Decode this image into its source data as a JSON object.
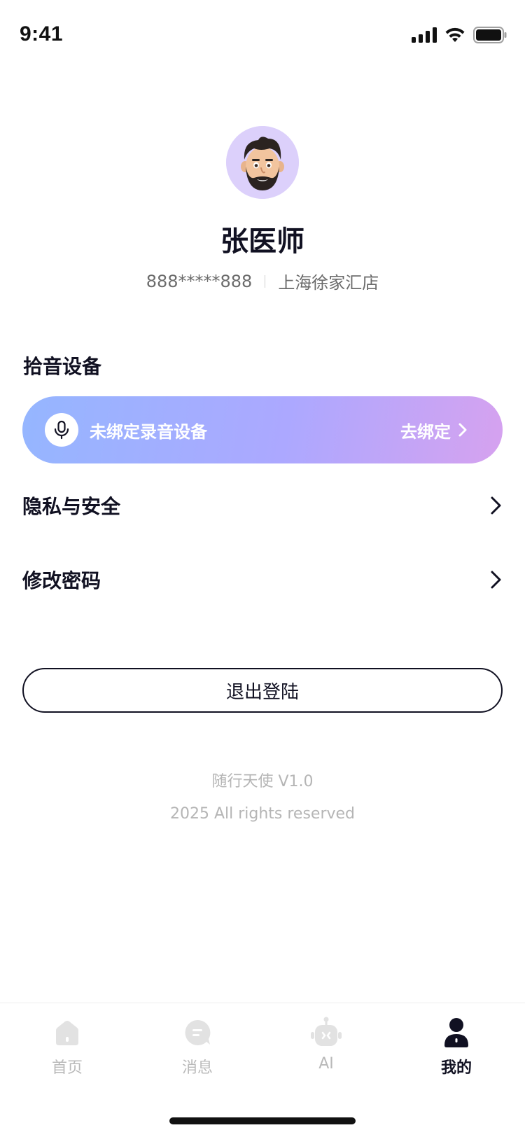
{
  "status_bar": {
    "time": "9:41"
  },
  "profile": {
    "name": "张医师",
    "phone": "888*****888",
    "store": "上海徐家汇店"
  },
  "device_section": {
    "title": "拾音设备",
    "status_text": "未绑定录音设备",
    "bind_label": "去绑定",
    "icon": "microphone-icon",
    "gradient_colors": [
      "#95b6ff",
      "#aca8ff",
      "#d6a2ef"
    ]
  },
  "menu": {
    "privacy": "隐私与安全",
    "password": "修改密码"
  },
  "logout_label": "退出登陆",
  "footer": {
    "version": "随行天使 V1.0",
    "copyright": "2025 All rights reserved"
  },
  "tabs": [
    {
      "label": "首页",
      "icon": "home-icon",
      "active": false
    },
    {
      "label": "消息",
      "icon": "message-icon",
      "active": false
    },
    {
      "label": "AI",
      "icon": "robot-icon",
      "active": false
    },
    {
      "label": "我的",
      "icon": "user-icon",
      "active": true
    }
  ],
  "colors": {
    "primary_text": "#111122",
    "secondary_text": "#6b6b6b",
    "muted_text": "#b5b5b5",
    "inactive_tab": "#d9d9d9"
  }
}
